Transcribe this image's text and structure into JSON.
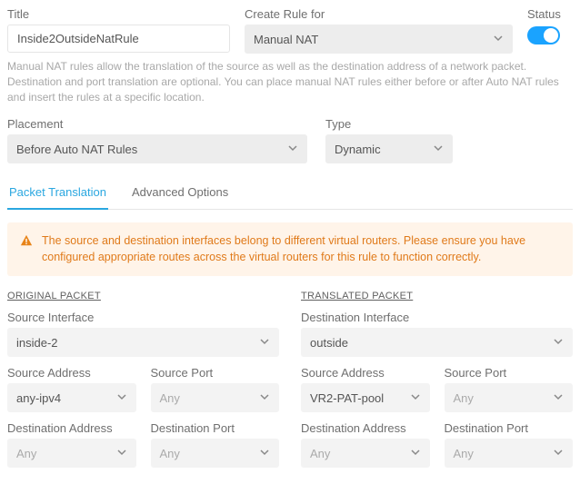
{
  "top": {
    "title_label": "Title",
    "title_value": "Inside2OutsideNatRule",
    "rulefor_label": "Create Rule for",
    "rulefor_value": "Manual NAT",
    "status_label": "Status"
  },
  "help": "Manual NAT rules allow the translation of the source as well as the destination address of a network packet. Destination and port translation are optional. You can place manual NAT rules either before or after Auto NAT rules and insert the rules at a specific location.",
  "placement": {
    "label": "Placement",
    "value": "Before Auto NAT Rules"
  },
  "type": {
    "label": "Type",
    "value": "Dynamic"
  },
  "tabs": {
    "packet": "Packet Translation",
    "advanced": "Advanced Options"
  },
  "alert": "The source and destination interfaces belong to different virtual routers. Please ensure you have configured appropriate routes across the virtual routers for this rule to function correctly.",
  "original": {
    "head": "ORIGINAL PACKET",
    "src_if_label": "Source Interface",
    "src_if_value": "inside-2",
    "src_addr_label": "Source Address",
    "src_addr_value": "any-ipv4",
    "src_port_label": "Source Port",
    "src_port_value": "Any",
    "dst_addr_label": "Destination Address",
    "dst_addr_value": "Any",
    "dst_port_label": "Destination Port",
    "dst_port_value": "Any"
  },
  "translated": {
    "head": "TRANSLATED PACKET",
    "dst_if_label": "Destination Interface",
    "dst_if_value": "outside",
    "src_addr_label": "Source Address",
    "src_addr_value": "VR2-PAT-pool",
    "src_port_label": "Source Port",
    "src_port_value": "Any",
    "dst_addr_label": "Destination Address",
    "dst_addr_value": "Any",
    "dst_port_label": "Destination Port",
    "dst_port_value": "Any"
  }
}
